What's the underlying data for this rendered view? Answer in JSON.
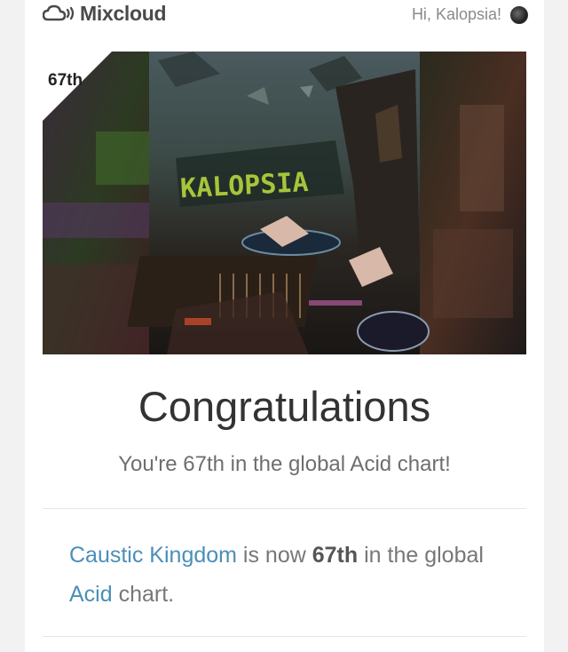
{
  "header": {
    "logo_text": "Mixcloud",
    "greeting": "Hi, Kalopsia!"
  },
  "banner": {
    "rank_badge": "67th",
    "artwork_text": "KALOPSIA"
  },
  "main": {
    "title": "Congratulations",
    "subtitle": "You're 67th in the global Acid chart!",
    "message": {
      "show_link": "Caustic Kingdom",
      "text_1": " is now ",
      "rank": "67th",
      "text_2": " in the global ",
      "genre_link": "Acid",
      "text_3": " chart."
    }
  },
  "colors": {
    "link": "#4b8fb8",
    "background": "#f2f2f2",
    "card": "#ffffff"
  }
}
